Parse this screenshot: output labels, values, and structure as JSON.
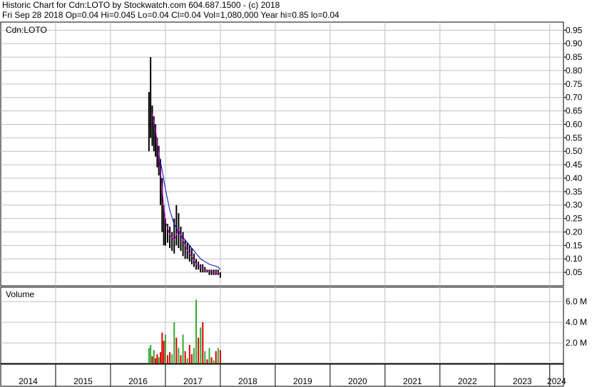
{
  "header": {
    "line1": "Historic Chart for Cdn:LOTO by Stockwatch.com 604.687.1500 - (c) 2018",
    "line2": "Fri Sep 28 2018  Op=0.04  Hi=0.045  Lo=0.04  Cl=0.04  Vol=1,080,000  Year hi=0.85  lo=0.04"
  },
  "chart_data": {
    "type": "line",
    "symbol_label": "Cdn:LOTO",
    "volume_label": "Volume",
    "price_axis": {
      "ticks": [
        "0.95",
        "0.90",
        "0.85",
        "0.80",
        "0.75",
        "0.70",
        "0.65",
        "0.60",
        "0.55",
        "0.50",
        "0.45",
        "0.40",
        "0.35",
        "0.30",
        "0.25",
        "0.20",
        "0.15",
        "0.10",
        "0.05"
      ],
      "ylim": [
        0.0,
        0.98
      ]
    },
    "volume_axis": {
      "ticks": [
        "6.0 M",
        "4.0 M",
        "2.0 M"
      ],
      "ylim": [
        0,
        7400000
      ]
    },
    "x_axis": {
      "years": [
        "2014",
        "2015",
        "2016",
        "2017",
        "2018",
        "2019",
        "2020",
        "2021",
        "2022",
        "2023",
        "2024"
      ],
      "xlim": [
        2014.0,
        2024.25
      ]
    },
    "grid": true,
    "colors": {
      "price": "#000000",
      "ma_short": "#cc00cc",
      "ma_long": "#0000cc",
      "vol_up": "#33aa33",
      "vol_down": "#dd0000"
    },
    "price_series": [
      {
        "x": 2016.7,
        "h": 0.72,
        "l": 0.5
      },
      {
        "x": 2016.73,
        "h": 0.85,
        "l": 0.55
      },
      {
        "x": 2016.76,
        "h": 0.67,
        "l": 0.52
      },
      {
        "x": 2016.79,
        "h": 0.63,
        "l": 0.5
      },
      {
        "x": 2016.82,
        "h": 0.6,
        "l": 0.48
      },
      {
        "x": 2016.85,
        "h": 0.55,
        "l": 0.44
      },
      {
        "x": 2016.88,
        "h": 0.52,
        "l": 0.41
      },
      {
        "x": 2016.91,
        "h": 0.47,
        "l": 0.3
      },
      {
        "x": 2016.94,
        "h": 0.4,
        "l": 0.2
      },
      {
        "x": 2016.97,
        "h": 0.3,
        "l": 0.15
      },
      {
        "x": 2017.0,
        "h": 0.25,
        "l": 0.15
      },
      {
        "x": 2017.04,
        "h": 0.23,
        "l": 0.16
      },
      {
        "x": 2017.08,
        "h": 0.22,
        "l": 0.14
      },
      {
        "x": 2017.12,
        "h": 0.2,
        "l": 0.13
      },
      {
        "x": 2017.16,
        "h": 0.25,
        "l": 0.12
      },
      {
        "x": 2017.2,
        "h": 0.3,
        "l": 0.15
      },
      {
        "x": 2017.24,
        "h": 0.27,
        "l": 0.14
      },
      {
        "x": 2017.28,
        "h": 0.22,
        "l": 0.13
      },
      {
        "x": 2017.32,
        "h": 0.2,
        "l": 0.11
      },
      {
        "x": 2017.36,
        "h": 0.17,
        "l": 0.1
      },
      {
        "x": 2017.4,
        "h": 0.16,
        "l": 0.1
      },
      {
        "x": 2017.44,
        "h": 0.15,
        "l": 0.09
      },
      {
        "x": 2017.48,
        "h": 0.14,
        "l": 0.08
      },
      {
        "x": 2017.52,
        "h": 0.12,
        "l": 0.07
      },
      {
        "x": 2017.56,
        "h": 0.1,
        "l": 0.06
      },
      {
        "x": 2017.6,
        "h": 0.09,
        "l": 0.06
      },
      {
        "x": 2017.64,
        "h": 0.08,
        "l": 0.05
      },
      {
        "x": 2017.68,
        "h": 0.08,
        "l": 0.05
      },
      {
        "x": 2017.72,
        "h": 0.07,
        "l": 0.05
      },
      {
        "x": 2017.76,
        "h": 0.06,
        "l": 0.05
      },
      {
        "x": 2017.8,
        "h": 0.06,
        "l": 0.04
      },
      {
        "x": 2017.84,
        "h": 0.06,
        "l": 0.04
      },
      {
        "x": 2017.88,
        "h": 0.06,
        "l": 0.04
      },
      {
        "x": 2017.92,
        "h": 0.06,
        "l": 0.04
      },
      {
        "x": 2017.96,
        "h": 0.06,
        "l": 0.04
      },
      {
        "x": 2018.0,
        "h": 0.05,
        "l": 0.03
      }
    ],
    "ma_short": [
      {
        "x": 2016.76,
        "y": 0.64
      },
      {
        "x": 2016.82,
        "y": 0.58
      },
      {
        "x": 2016.88,
        "y": 0.49
      },
      {
        "x": 2016.94,
        "y": 0.36
      },
      {
        "x": 2017.0,
        "y": 0.24
      },
      {
        "x": 2017.08,
        "y": 0.19
      },
      {
        "x": 2017.16,
        "y": 0.17
      },
      {
        "x": 2017.24,
        "y": 0.21
      },
      {
        "x": 2017.32,
        "y": 0.17
      },
      {
        "x": 2017.4,
        "y": 0.13
      },
      {
        "x": 2017.48,
        "y": 0.11
      },
      {
        "x": 2017.56,
        "y": 0.08
      },
      {
        "x": 2017.64,
        "y": 0.07
      },
      {
        "x": 2017.72,
        "y": 0.06
      },
      {
        "x": 2017.8,
        "y": 0.055
      },
      {
        "x": 2017.88,
        "y": 0.05
      },
      {
        "x": 2017.96,
        "y": 0.05
      },
      {
        "x": 2018.0,
        "y": 0.04
      }
    ],
    "ma_long": [
      {
        "x": 2016.88,
        "y": 0.49
      },
      {
        "x": 2016.94,
        "y": 0.43
      },
      {
        "x": 2017.0,
        "y": 0.36
      },
      {
        "x": 2017.08,
        "y": 0.28
      },
      {
        "x": 2017.16,
        "y": 0.23
      },
      {
        "x": 2017.24,
        "y": 0.2
      },
      {
        "x": 2017.32,
        "y": 0.18
      },
      {
        "x": 2017.4,
        "y": 0.16
      },
      {
        "x": 2017.48,
        "y": 0.14
      },
      {
        "x": 2017.56,
        "y": 0.12
      },
      {
        "x": 2017.64,
        "y": 0.1
      },
      {
        "x": 2017.72,
        "y": 0.09
      },
      {
        "x": 2017.8,
        "y": 0.08
      },
      {
        "x": 2017.88,
        "y": 0.075
      },
      {
        "x": 2017.96,
        "y": 0.07
      },
      {
        "x": 2018.0,
        "y": 0.06
      }
    ],
    "volume": [
      {
        "x": 2016.7,
        "v": 1500000,
        "up": true
      },
      {
        "x": 2016.73,
        "v": 1800000,
        "up": true
      },
      {
        "x": 2016.76,
        "v": 700000,
        "up": false
      },
      {
        "x": 2016.79,
        "v": 1300000,
        "up": true
      },
      {
        "x": 2016.82,
        "v": 500000,
        "up": false
      },
      {
        "x": 2016.85,
        "v": 900000,
        "up": false
      },
      {
        "x": 2016.88,
        "v": 600000,
        "up": true
      },
      {
        "x": 2016.91,
        "v": 1100000,
        "up": false
      },
      {
        "x": 2016.94,
        "v": 3000000,
        "up": false
      },
      {
        "x": 2016.97,
        "v": 2200000,
        "up": false
      },
      {
        "x": 2017.0,
        "v": 2800000,
        "up": true
      },
      {
        "x": 2017.04,
        "v": 800000,
        "up": false
      },
      {
        "x": 2017.08,
        "v": 1100000,
        "up": false
      },
      {
        "x": 2017.12,
        "v": 900000,
        "up": true
      },
      {
        "x": 2017.16,
        "v": 4000000,
        "up": true
      },
      {
        "x": 2017.2,
        "v": 2500000,
        "up": false
      },
      {
        "x": 2017.24,
        "v": 1500000,
        "up": true
      },
      {
        "x": 2017.28,
        "v": 800000,
        "up": false
      },
      {
        "x": 2017.32,
        "v": 2800000,
        "up": true
      },
      {
        "x": 2017.36,
        "v": 1200000,
        "up": false
      },
      {
        "x": 2017.4,
        "v": 500000,
        "up": true
      },
      {
        "x": 2017.44,
        "v": 1800000,
        "up": false
      },
      {
        "x": 2017.48,
        "v": 900000,
        "up": false
      },
      {
        "x": 2017.52,
        "v": 1500000,
        "up": true
      },
      {
        "x": 2017.56,
        "v": 6200000,
        "up": true
      },
      {
        "x": 2017.6,
        "v": 2500000,
        "up": false
      },
      {
        "x": 2017.64,
        "v": 3500000,
        "up": true
      },
      {
        "x": 2017.68,
        "v": 4000000,
        "up": false
      },
      {
        "x": 2017.72,
        "v": 1200000,
        "up": true
      },
      {
        "x": 2017.76,
        "v": 400000,
        "up": false
      },
      {
        "x": 2017.8,
        "v": 1500000,
        "up": true
      },
      {
        "x": 2017.84,
        "v": 600000,
        "up": false
      },
      {
        "x": 2017.88,
        "v": 300000,
        "up": true
      },
      {
        "x": 2017.92,
        "v": 1200000,
        "up": false
      },
      {
        "x": 2017.96,
        "v": 1500000,
        "up": true
      },
      {
        "x": 2018.0,
        "v": 1300000,
        "up": false
      }
    ]
  }
}
